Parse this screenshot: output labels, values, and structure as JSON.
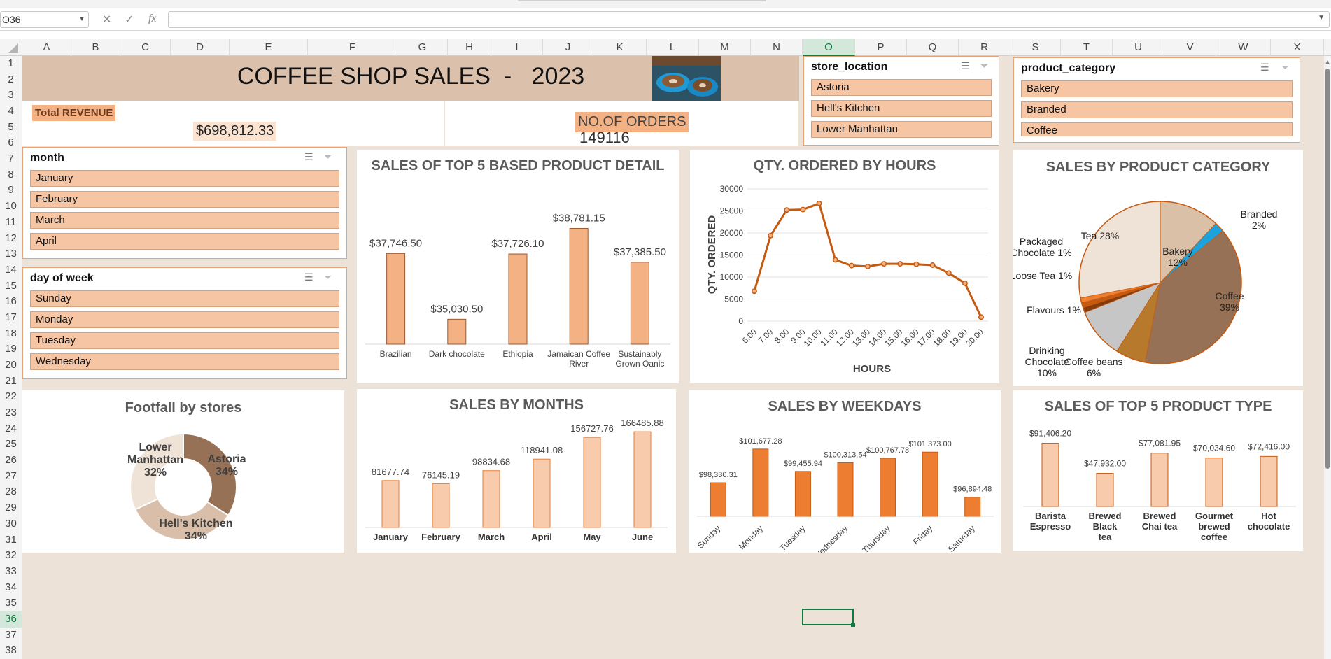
{
  "toolbar": {
    "name_box": "O36",
    "fx_label": "fx"
  },
  "columns": [
    "A",
    "B",
    "C",
    "D",
    "E",
    "F",
    "G",
    "H",
    "I",
    "J",
    "K",
    "L",
    "M",
    "N",
    "O",
    "P",
    "Q",
    "R",
    "S",
    "T",
    "U",
    "V",
    "W",
    "X"
  ],
  "selected_column": "O",
  "rows": [
    "1",
    "2",
    "3",
    "4",
    "5",
    "6",
    "7",
    "8",
    "9",
    "10",
    "11",
    "12",
    "13",
    "14",
    "15",
    "16",
    "17",
    "18",
    "19",
    "20",
    "21",
    "22",
    "23",
    "24",
    "25",
    "26",
    "27",
    "28",
    "29",
    "30",
    "31",
    "32",
    "33",
    "34",
    "35",
    "36",
    "37",
    "38"
  ],
  "selected_row": "36",
  "dashboard": {
    "title": "COFFEE SHOP SALES  -   2023",
    "total_revenue_label": "Total REVENUE",
    "total_revenue_value": "$698,812.33",
    "orders_label": "NO.OF ORDERS",
    "orders_value": "149116"
  },
  "slicers": {
    "store_location": {
      "title": "store_location",
      "items": [
        "Astoria",
        "Hell's Kitchen",
        "Lower Manhattan"
      ]
    },
    "product_category": {
      "title": "product_category",
      "items": [
        "Bakery",
        "Branded",
        "Coffee"
      ]
    },
    "month": {
      "title": "month",
      "items": [
        "January",
        "February",
        "March",
        "April"
      ]
    },
    "day_of_week": {
      "title": "day of week",
      "items": [
        "Sunday",
        "Monday",
        "Tuesday",
        "Wednesday"
      ]
    }
  },
  "charts": {
    "top5_product_detail": {
      "title": "SALES OF TOP 5  BASED PRODUCT DETAIL",
      "type": "bar",
      "categories": [
        "Brazilian",
        "Dark chocolate",
        "Ethiopia",
        "Jamaican Coffee River",
        "Sustainably Grown Oanic"
      ],
      "values": [
        37746.5,
        35030.5,
        37726.1,
        38781.15,
        37385.5
      ],
      "labels": [
        "$37,746.50",
        "$35,030.50",
        "$37,726.10",
        "$38,781.15",
        "$37,385.50"
      ],
      "ylim": [
        34000,
        39200
      ],
      "color": "#f4b183",
      "border": "#9c5a33"
    },
    "qty_by_hours": {
      "title": "QTY. ORDERED BY HOURS",
      "type": "line",
      "x": [
        "6.00",
        "7.00",
        "8.00",
        "9.00",
        "10.00",
        "11.00",
        "12.00",
        "13.00",
        "14.00",
        "15.00",
        "16.00",
        "17.00",
        "18.00",
        "19.00",
        "20.00"
      ],
      "values": [
        6800,
        19400,
        25200,
        25300,
        26700,
        13900,
        12600,
        12400,
        13000,
        13000,
        12900,
        12700,
        10900,
        8600,
        900
      ],
      "yticks": [
        0,
        5000,
        10000,
        15000,
        20000,
        25000,
        30000
      ],
      "ylim": [
        0,
        30000
      ],
      "xlabel": "HOURS",
      "ylabel": "QTY. ORDERED",
      "color": "#c55a11"
    },
    "sales_by_product_category": {
      "title": "SALES BY PRODUCT CATEGORY",
      "type": "pie",
      "slices": [
        {
          "name": "Bakery",
          "pct": "12%",
          "value": 12,
          "color": "#dbc0a8"
        },
        {
          "name": "Branded",
          "pct": "2%",
          "value": 2,
          "color": "#1ca3de"
        },
        {
          "name": "Coffee",
          "pct": "39%",
          "value": 39,
          "color": "#967156"
        },
        {
          "name": "Coffee beans",
          "pct": "6%",
          "value": 6,
          "color": "#b7792c"
        },
        {
          "name": "Drinking Chocolate",
          "pct": "10%",
          "value": 10,
          "color": "#c6c6c6"
        },
        {
          "name": "Flavours",
          "pct": "1%",
          "value": 1,
          "color": "#843c0c"
        },
        {
          "name": "Loose Tea",
          "pct": "1%",
          "value": 1,
          "color": "#c55a11"
        },
        {
          "name": "Packaged Chocolate",
          "pct": "1%",
          "value": 1,
          "color": "#f08030"
        },
        {
          "name": "Tea",
          "pct": "28%",
          "value": 28,
          "color": "#efe3d7"
        }
      ]
    },
    "footfall_by_stores": {
      "title": "Footfall by stores",
      "type": "pie",
      "slices": [
        {
          "name": "Astoria",
          "pct": "34%",
          "value": 34,
          "color": "#967156"
        },
        {
          "name": "Hell's Kitchen",
          "pct": "34%",
          "value": 34,
          "color": "#d9bfa9"
        },
        {
          "name": "Lower Manhattan",
          "pct": "32%",
          "value": 32,
          "color": "#efe3d7"
        }
      ]
    },
    "sales_by_months": {
      "title": "SALES BY MONTHS",
      "type": "bar",
      "categories": [
        "January",
        "February",
        "March",
        "April",
        "May",
        "June"
      ],
      "values": [
        81677.74,
        76145.19,
        98834.68,
        118941.08,
        156727.76,
        166485.88
      ],
      "labels": [
        "81677.74",
        "76145.19",
        "98834.68",
        "118941.08",
        "156727.76",
        "166485.88"
      ],
      "ylim": [
        0,
        180000
      ],
      "color": "#f8cbad",
      "border": "#ed7d31"
    },
    "sales_by_weekdays": {
      "title": "SALES BY WEEKDAYS",
      "type": "bar",
      "categories": [
        "Sunday",
        "Monday",
        "Tuesday",
        "Wednesday",
        "Thursday",
        "Friday",
        "Saturday"
      ],
      "values": [
        98330.31,
        101677.28,
        99455.94,
        100313.54,
        100767.78,
        101373.0,
        96894.48
      ],
      "labels": [
        "$98,330.31",
        "$101,677.28",
        "$99,455.94",
        "$100,313.54",
        "$100,767.78",
        "$101,373.00",
        "$96,894.48"
      ],
      "ylim": [
        95000,
        102500
      ],
      "color": "#ed7d31",
      "border": "#c55a11"
    },
    "top5_product_type": {
      "title": "SALES OF TOP 5  PRODUCT TYPE",
      "type": "bar",
      "categories": [
        "Barista Espresso",
        "Brewed Black tea",
        "Brewed Chai tea",
        "Gourmet brewed coffee",
        "Hot chocolate"
      ],
      "values": [
        91406.2,
        47932.0,
        77081.95,
        70034.6,
        72416.0
      ],
      "labels": [
        "$91,406.20",
        "$47,932.00",
        "$77,081.95",
        "$70,034.60",
        "$72,416.00"
      ],
      "ylim": [
        0,
        95000
      ],
      "color": "#f8cbad",
      "border": "#c55a11"
    }
  }
}
